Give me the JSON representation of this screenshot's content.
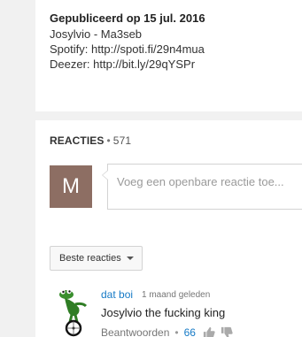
{
  "description": {
    "published": "Gepubliceerd op 15 jul. 2016",
    "lines": [
      "Josylvio - Ma3seb",
      "Spotify: http://spoti.fi/29n4mua",
      "Deezer: http://bit.ly/29qYSPr"
    ]
  },
  "comments": {
    "title": "Reacties",
    "separator": "•",
    "count": "571",
    "avatar_letter": "M",
    "input_placeholder": "Voeg een openbare reactie toe...",
    "sort_label": "Beste reacties",
    "items": [
      {
        "author": "dat boi",
        "time": "1 maand geleden",
        "text": "Josylvio the fucking king",
        "reply_label": "Beantwoorden",
        "likes": "66",
        "avatar_icon": "frog-on-unicycle-avatar"
      }
    ]
  },
  "colors": {
    "link_blue": "#167ac6",
    "avatar_brown": "#8d6e63",
    "page_bg": "#f1f1f1"
  }
}
